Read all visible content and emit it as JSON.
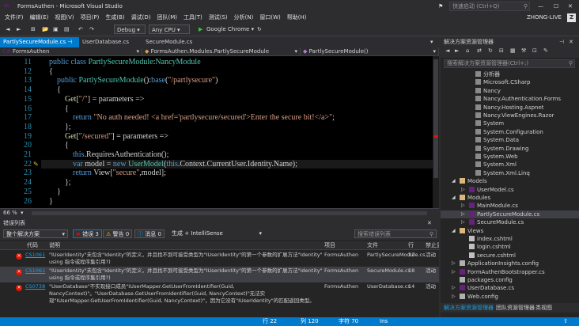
{
  "window": {
    "title": "FormsAuthen - Microsoft Visual Studio",
    "quick_launch": "快速启动 (Ctrl+Q)",
    "user": "ZHONG-LIVE",
    "avatar": "Z"
  },
  "menu": [
    "文件(F)",
    "编辑(E)",
    "视图(V)",
    "项目(P)",
    "生成(B)",
    "调试(D)",
    "团队(M)",
    "工具(T)",
    "测试(S)",
    "分析(N)",
    "窗口(W)",
    "帮助(H)"
  ],
  "toolbar": {
    "config": "Debug",
    "platform": "Any CPU",
    "run": "Google Chrome"
  },
  "tabs": [
    {
      "label": "PartlySecureModule.cs",
      "active": true
    },
    {
      "label": "UserDatabase.cs",
      "active": false
    },
    {
      "label": "SecureModule.cs",
      "active": false
    }
  ],
  "nav": {
    "project": "FormsAuthen",
    "class": "FormsAuthen.Modules.PartlySecureModule",
    "member": "PartlySecureModule()"
  },
  "editor": {
    "line_numbers": [
      "11",
      "12",
      "13",
      "14",
      "15",
      "16",
      "17",
      "18",
      "19",
      "20",
      "21",
      "22",
      "23",
      "24",
      "25",
      "26"
    ],
    "lines": [
      [
        [
          "    ",
          "pl"
        ],
        [
          "public class ",
          "kw"
        ],
        [
          "PartlySecureModule",
          "ty"
        ],
        [
          ":",
          "pl"
        ],
        [
          "NancyModule",
          "ty"
        ]
      ],
      [
        [
          "    {",
          "pl"
        ]
      ],
      [
        [
          "        ",
          "pl"
        ],
        [
          "public ",
          "kw"
        ],
        [
          "PartlySecureModule",
          "ty"
        ],
        [
          "():",
          "pl"
        ],
        [
          "base",
          "kw"
        ],
        [
          "(",
          "pl"
        ],
        [
          "\"/partlysecure\"",
          "st"
        ],
        [
          ")",
          "pl"
        ]
      ],
      [
        [
          "        {",
          "pl"
        ]
      ],
      [
        [
          "            ",
          "pl"
        ],
        [
          "Get",
          "me"
        ],
        [
          "[",
          "pl"
        ],
        [
          "\"/\"",
          "st"
        ],
        [
          "] = parameters =>",
          "pl"
        ]
      ],
      [
        [
          "            {",
          "pl"
        ]
      ],
      [
        [
          "                ",
          "pl"
        ],
        [
          "return ",
          "kw"
        ],
        [
          "\"No auth needed! <a href='partlysecure/secured'>Enter the secure bit!</a>\"",
          "st"
        ],
        [
          ";",
          "pl"
        ]
      ],
      [
        [
          "            };",
          "pl"
        ]
      ],
      [
        [
          "            ",
          "pl"
        ],
        [
          "Get",
          "me"
        ],
        [
          "[",
          "pl"
        ],
        [
          "\"/secured\"",
          "st"
        ],
        [
          "] = parameters =>",
          "pl"
        ]
      ],
      [
        [
          "            {",
          "pl"
        ]
      ],
      [
        [
          "                ",
          "pl"
        ],
        [
          "this",
          "kw"
        ],
        [
          ".RequiresAuthentication();",
          "pl"
        ]
      ],
      [
        [
          "                ",
          "pl"
        ],
        [
          "var ",
          "kw"
        ],
        [
          "model = ",
          "pl"
        ],
        [
          "new ",
          "kw"
        ],
        [
          "UserModel",
          "ty"
        ],
        [
          "(",
          "pl"
        ],
        [
          "this",
          "kw"
        ],
        [
          ".Context.CurrentUser.Identity.Name);",
          "pl"
        ]
      ],
      [
        [
          "                ",
          "pl"
        ],
        [
          "return ",
          "kw"
        ],
        [
          "View[",
          "pl"
        ],
        [
          "\"secure\"",
          "st"
        ],
        [
          ",model];",
          "pl"
        ]
      ],
      [
        [
          "            };",
          "pl"
        ]
      ],
      [
        [
          "        }",
          "pl"
        ]
      ],
      [
        [
          "    }",
          "pl"
        ]
      ]
    ],
    "zoom": "66 %"
  },
  "error_list": {
    "title": "错误列表",
    "scope": "整个解决方案",
    "errors": "错误 3",
    "warnings": "警告 0",
    "messages": "消息 0",
    "build": "生成 + IntelliSense",
    "search": "搜索错误列表",
    "columns": [
      "代码",
      "说明",
      "项目",
      "文件",
      "行",
      "禁止显示状态"
    ],
    "rows": [
      {
        "code": "CS1061",
        "desc1": "\"IUserIdentity\"未包含\"Identity\"的定义，并且找不到可接受类型为\"IUserIdentity\"的第一个参数的扩展方法\"Identity\"(是否缺少",
        "desc2": "using 指令或程序集引用?)",
        "project": "FormsAuthen",
        "file1": "PartlySecureModule.cs",
        "file2": "",
        "line": "22",
        "state": "活动"
      },
      {
        "code": "CS1061",
        "desc1": "\"IUserIdentity\"未包含\"Identity\"的定义，并且找不到可接受类型为\"IUserIdentity\"的第一个参数的扩展方法\"Identity\"(是否缺少",
        "desc2": "using 指令或程序集引用?)",
        "project": "FormsAuthen",
        "file1": "SecureModule.cs",
        "file2": "",
        "line": "18",
        "state": "活动"
      },
      {
        "code": "CS0738",
        "desc1": "\"UserDatabase\"不实现接口成员\"IUserMapper.GetUserFromIdentifier(Guid,",
        "desc2": "NancyContext)\"。\"UserDatabase.GetUserFromIdentifier(Guid, NancyContext)\"无法实",
        "desc3": "现\"IUserMapper.GetUserFromIdentifier(Guid, NancyContext)\"，因为它没有\"IUserIdentity\"的匹配返回类型。",
        "project": "FormsAuthen",
        "file1": "UserDatabase.cs",
        "file2": "",
        "line": "14",
        "state": "活动"
      }
    ]
  },
  "solution_explorer": {
    "title": "解决方案资源管理器",
    "search": "搜索解决方案资源管理器(Ctrl+;)",
    "items": [
      {
        "label": "分析器",
        "depth": 3,
        "icon": "analyzer-icon"
      },
      {
        "label": "Microsoft.CSharp",
        "depth": 3,
        "icon": "reference-icon"
      },
      {
        "label": "Nancy",
        "depth": 3,
        "icon": "reference-icon"
      },
      {
        "label": "Nancy.Authentication.Forms",
        "depth": 3,
        "icon": "reference-icon"
      },
      {
        "label": "Nancy.Hosting.Aspnet",
        "depth": 3,
        "icon": "reference-icon"
      },
      {
        "label": "Nancy.ViewEngines.Razor",
        "depth": 3,
        "icon": "reference-icon"
      },
      {
        "label": "System",
        "depth": 3,
        "icon": "reference-icon"
      },
      {
        "label": "System.Configuration",
        "depth": 3,
        "icon": "reference-icon"
      },
      {
        "label": "System.Data",
        "depth": 3,
        "icon": "reference-icon"
      },
      {
        "label": "System.Drawing",
        "depth": 3,
        "icon": "reference-icon"
      },
      {
        "label": "System.Web",
        "depth": 3,
        "icon": "reference-icon"
      },
      {
        "label": "System.Xml",
        "depth": 3,
        "icon": "reference-icon"
      },
      {
        "label": "System.Xml.Linq",
        "depth": 3,
        "icon": "reference-icon"
      },
      {
        "label": "Models",
        "depth": 1,
        "icon": "folder-icon",
        "arrow": "▲"
      },
      {
        "label": "UserModel.cs",
        "depth": 2,
        "icon": "csharp-file-icon",
        "arrow": "▷"
      },
      {
        "label": "Modules",
        "depth": 1,
        "icon": "folder-icon",
        "arrow": "▲"
      },
      {
        "label": "MainModule.cs",
        "depth": 2,
        "icon": "csharp-file-icon",
        "arrow": "▷"
      },
      {
        "label": "PartlySecureModule.cs",
        "depth": 2,
        "icon": "csharp-file-icon",
        "arrow": "▷",
        "selected": true
      },
      {
        "label": "SecureModule.cs",
        "depth": 2,
        "icon": "csharp-file-icon",
        "arrow": "▷"
      },
      {
        "label": "Views",
        "depth": 1,
        "icon": "folder-icon",
        "arrow": "▲"
      },
      {
        "label": "index.cshtml",
        "depth": 2,
        "icon": "cshtml-file-icon"
      },
      {
        "label": "login.cshtml",
        "depth": 2,
        "icon": "cshtml-file-icon"
      },
      {
        "label": "secure.cshtml",
        "depth": 2,
        "icon": "cshtml-file-icon"
      },
      {
        "label": "ApplicationInsights.config",
        "depth": 1,
        "icon": "config-file-icon",
        "arrow": "▷"
      },
      {
        "label": "FormAuthenBootstrapper.cs",
        "depth": 1,
        "icon": "csharp-file-icon",
        "arrow": "▷"
      },
      {
        "label": "packages.config",
        "depth": 1,
        "icon": "config-file-icon"
      },
      {
        "label": "UserDatabase.cs",
        "depth": 1,
        "icon": "csharp-file-icon",
        "arrow": "▷"
      },
      {
        "label": "Web.config",
        "depth": 1,
        "icon": "config-file-icon",
        "arrow": "▷"
      }
    ],
    "bottom_tabs": [
      "解决方案资源管理器",
      "团队资源管理器",
      "类视图"
    ]
  },
  "status": {
    "row": "行 22",
    "col": "列 120",
    "char": "字符 70",
    "mode": "Ins"
  },
  "colors": {
    "accent": "#007acc",
    "error": "#e51400",
    "keyword": "#569cd6",
    "type": "#4ec9b0",
    "string": "#d69d85"
  }
}
